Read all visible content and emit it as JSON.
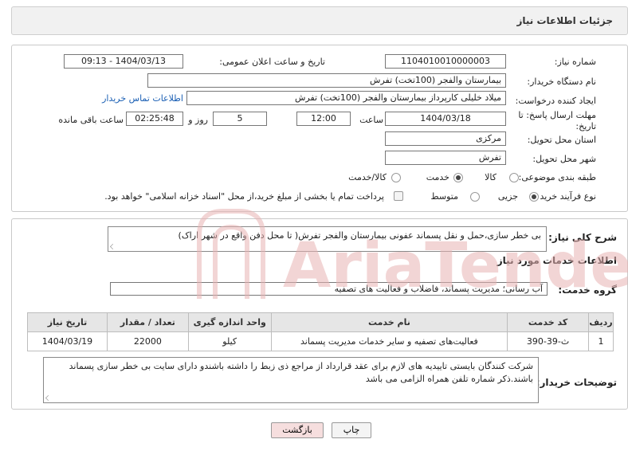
{
  "page_title": "جزئیات اطلاعات نیاز",
  "fields": {
    "need_number_label": "شماره نیاز:",
    "need_number": "1104010010000003",
    "announce_label": "تاریخ و ساعت اعلان عمومی:",
    "announce_value": "1404/03/13 - 09:13",
    "buyer_org_label": "نام دستگاه خریدار:",
    "buyer_org": "بیمارستان والفجر (100تخت) تفرش",
    "creator_label": "ایجاد کننده درخواست:",
    "creator": "میلاد خلیلی کارپرداز بیمارستان والفجر (100تخت) تفرش",
    "buyer_contact_link": "اطلاعات تماس خریدار",
    "deadline_label": "مهلت ارسال پاسخ: تا تاریخ:",
    "deadline_date": "1404/03/18",
    "time_label": "ساعت",
    "deadline_time": "12:00",
    "days_value": "5",
    "days_label": "روز و",
    "remaining_time": "02:25:48",
    "remaining_label": "ساعت باقی مانده",
    "province_label": "استان محل تحویل:",
    "province": "مرکزی",
    "city_label": "شهر محل تحویل:",
    "city": "تفرش",
    "category_label": "طبقه بندی موضوعی:",
    "category_options": [
      "کالا",
      "خدمت",
      "کالا/خدمت"
    ],
    "category_selected": "خدمت",
    "process_label": "نوع فرآیند خرید :",
    "process_options": [
      "جزیی",
      "متوسط"
    ],
    "process_selected": "جزیی",
    "payment_note": "پرداخت تمام یا بخشی از مبلغ خرید،از محل \"اسناد خزانه اسلامی\" خواهد بود."
  },
  "summary": {
    "label": "شرح کلی نیاز:",
    "text": "بی خطر سازی،حمل و نقل پسماند عفونی بیمارستان والفجر تفرش( تا محل دفن واقع در شهر اراک)"
  },
  "services": {
    "section_title": "اطلاعات خدمات مورد نیاز",
    "group_label": "گروه خدمت:",
    "group_value": "آب رسانی؛ مدیریت پسماند، فاضلاب و فعالیت های تصفیه",
    "columns": [
      "ردیف",
      "کد خدمت",
      "نام خدمت",
      "واحد اندازه گیری",
      "تعداد / مقدار",
      "تاریخ نیاز"
    ],
    "rows": [
      [
        "1",
        "ث-39-390",
        "فعالیت‌های تصفیه و سایر خدمات مدیریت پسماند",
        "کیلو",
        "22000",
        "1404/03/19"
      ]
    ]
  },
  "buyer_notes": {
    "label": "توضیحات خریدار:",
    "text": "شرکت کنندگان بایستی تاییدیه های لازم برای عقد قرارداد از مراجع ذی زبط را داشته باشندو دارای سایت بی خطر سازی پسماند باشند.ذکر شماره تلفن همراه الزامی می باشد"
  },
  "buttons": {
    "print": "چاپ",
    "back": "بازگشت"
  },
  "watermark_text": "AriaTender.neT",
  "colors": {
    "link": "#1a5fb4",
    "watermark": "#e8b3b3",
    "back_button_bg": "#f6dede"
  }
}
